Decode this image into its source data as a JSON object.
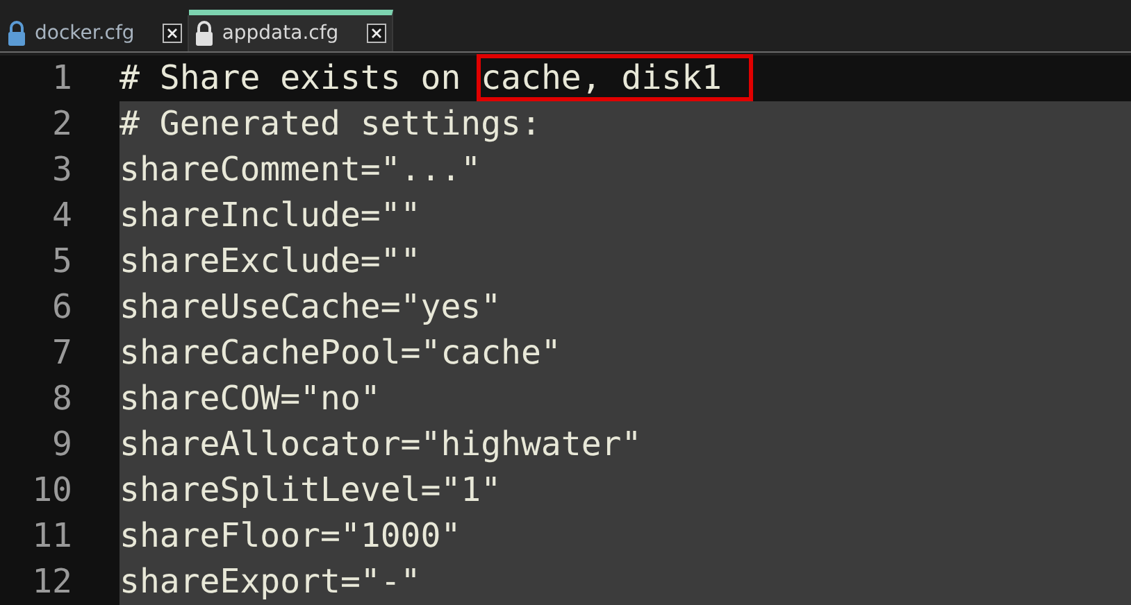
{
  "tabs": [
    {
      "label": "docker.cfg",
      "selected": false
    },
    {
      "label": "appdata.cfg",
      "selected": true
    }
  ],
  "lines": [
    {
      "number": "1",
      "text": "# Share exists on ",
      "highlight": "cache, disk1",
      "current": true
    },
    {
      "number": "2",
      "text": "# Generated settings:",
      "current": false
    },
    {
      "number": "3",
      "text": "shareComment=\"...\"",
      "current": false
    },
    {
      "number": "4",
      "text": "shareInclude=\"\"",
      "current": false
    },
    {
      "number": "5",
      "text": "shareExclude=\"\"",
      "current": false
    },
    {
      "number": "6",
      "text": "shareUseCache=\"yes\"",
      "current": false
    },
    {
      "number": "7",
      "text": "shareCachePool=\"cache\"",
      "current": false
    },
    {
      "number": "8",
      "text": "shareCOW=\"no\"",
      "current": false
    },
    {
      "number": "9",
      "text": "shareAllocator=\"highwater\"",
      "current": false
    },
    {
      "number": "10",
      "text": "shareSplitLevel=\"1\"",
      "current": false
    },
    {
      "number": "11",
      "text": "shareFloor=\"1000\"",
      "current": false
    },
    {
      "number": "12",
      "text": "shareExport=\"-\"",
      "current": false
    }
  ]
}
